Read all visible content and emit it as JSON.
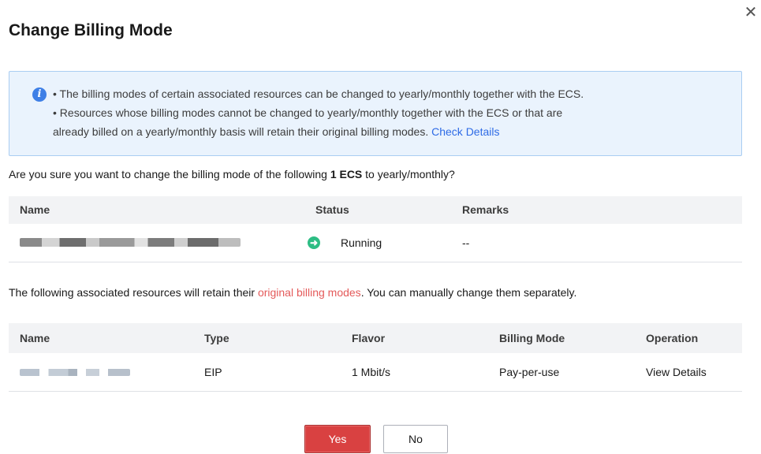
{
  "dialog": {
    "title": "Change Billing Mode",
    "close_icon": "close-icon"
  },
  "info": {
    "icon": "info-icon",
    "line1": "• The billing modes of certain associated resources can be changed to yearly/monthly together with the ECS.",
    "line2": "• Resources whose billing modes cannot be changed to yearly/monthly together with the ECS or that are",
    "line3": "already billed on a yearly/monthly basis will retain their original billing modes.",
    "link": "Check Details"
  },
  "question": {
    "prefix": "Are you sure you want to change the billing mode of the following",
    "count": "1 ECS",
    "suffix": "to yearly/monthly?"
  },
  "ecs_table": {
    "headers": [
      "Name",
      "Status",
      "Remarks"
    ],
    "rows": [
      {
        "name": "",
        "status": "Running",
        "remarks": "--"
      }
    ]
  },
  "note": {
    "prefix": "The following associated resources will retain their",
    "highlight": "original billing modes",
    "suffix": ". You can manually change them separately."
  },
  "resource_table": {
    "headers": [
      "Name",
      "Type",
      "Flavor",
      "Billing Mode",
      "Operation"
    ],
    "rows": [
      {
        "name": "",
        "type": "EIP",
        "flavor": "1 Mbit/s",
        "billing_mode": "Pay-per-use",
        "operation": "View Details"
      }
    ]
  },
  "buttons": {
    "yes": "Yes",
    "no": "No"
  },
  "colors": {
    "primary_button": "#d94141",
    "link": "#2e6be6",
    "highlight": "#e45a5a",
    "running": "#2dbd84",
    "info_bg": "#eaf3fd"
  }
}
